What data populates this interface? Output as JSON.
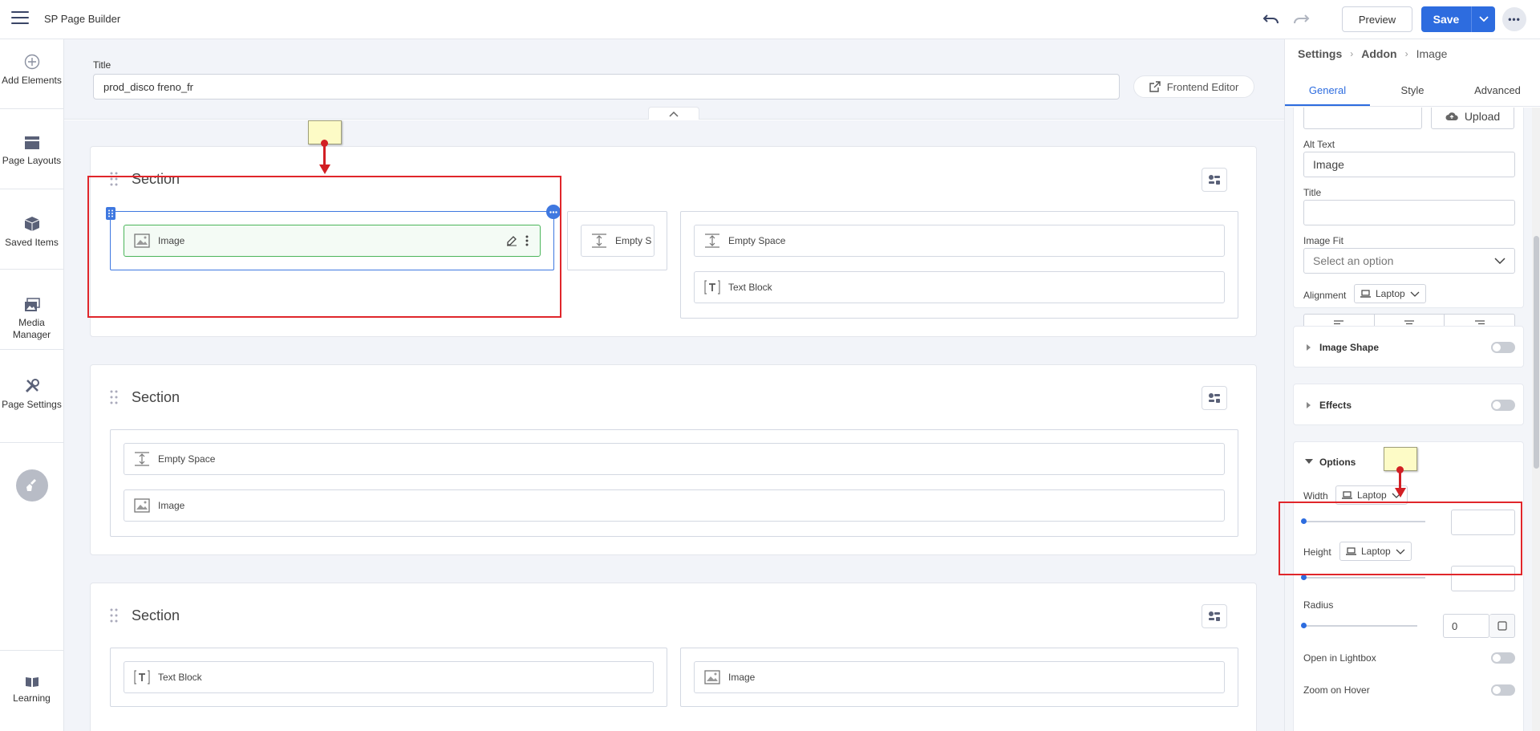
{
  "app": {
    "title": "SP Page Builder"
  },
  "toolbar": {
    "preview_label": "Preview",
    "save_label": "Save"
  },
  "rail": {
    "items": [
      {
        "label": "Add Elements",
        "icon": "plus-circle-icon"
      },
      {
        "label": "Page Layouts",
        "icon": "layout-icon"
      },
      {
        "label": "Saved Items",
        "icon": "box-icon"
      },
      {
        "label": "Media Manager",
        "icon": "images-icon"
      },
      {
        "label": "Page Settings",
        "icon": "tools-icon"
      }
    ],
    "learning_label": "Learning"
  },
  "page": {
    "title_label": "Title",
    "title_value": "prod_disco freno_fr",
    "frontend_editor_label": "Frontend Editor"
  },
  "sections": [
    {
      "title": "Section",
      "columns": [
        {
          "addons": [
            "Image"
          ]
        },
        {
          "addons": [
            "Empty S"
          ]
        },
        {
          "addons": [
            "Empty Space",
            "Text Block"
          ]
        }
      ]
    },
    {
      "title": "Section",
      "columns": [
        {
          "addons": [
            "Empty Space",
            "Image"
          ]
        }
      ]
    },
    {
      "title": "Section",
      "columns": [
        {
          "addons": [
            "Text Block"
          ]
        },
        {
          "addons": [
            "Image"
          ]
        }
      ]
    }
  ],
  "panel": {
    "breadcrumb": [
      "Settings",
      "Addon",
      "Image"
    ],
    "tabs": [
      "General",
      "Style",
      "Advanced"
    ],
    "active_tab": "General",
    "upload_label": "Upload",
    "alt_text_label": "Alt Text",
    "alt_text_value": "Image",
    "title_label": "Title",
    "title_value": "",
    "image_fit_label": "Image Fit",
    "image_fit_placeholder": "Select an option",
    "alignment_label": "Alignment",
    "device_label": "Laptop",
    "image_shape_label": "Image Shape",
    "effects_label": "Effects",
    "options_label": "Options",
    "width_label": "Width",
    "height_label": "Height",
    "radius_label": "Radius",
    "radius_value": "0",
    "lightbox_label": "Open in Lightbox",
    "zoom_label": "Zoom on Hover"
  },
  "colors": {
    "accent": "#2d6cdf",
    "annotation": "#e0262b",
    "selected_addon": "#4bb55a"
  }
}
